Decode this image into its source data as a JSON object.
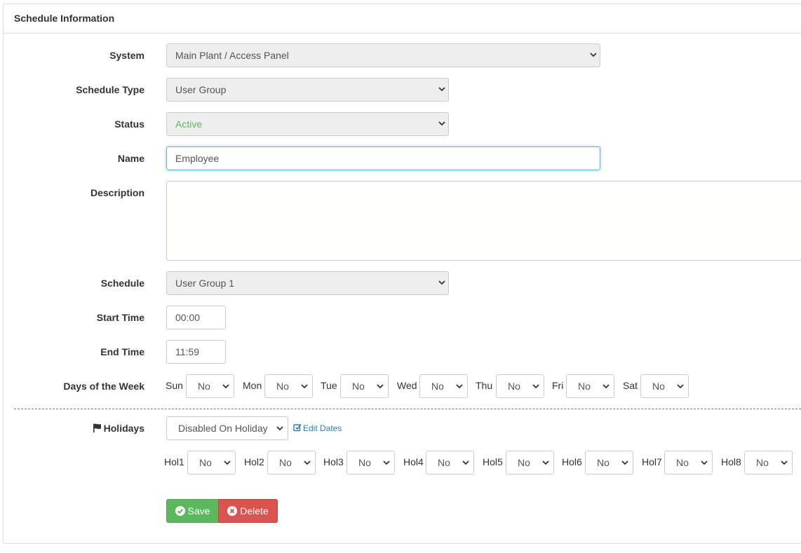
{
  "panel": {
    "title": "Schedule Information"
  },
  "form": {
    "system": {
      "label": "System",
      "value": "Main Plant / Access Panel"
    },
    "schedule_type": {
      "label": "Schedule Type",
      "value": "User Group"
    },
    "status": {
      "label": "Status",
      "value": "Active"
    },
    "name": {
      "label": "Name",
      "value": "Employee"
    },
    "description": {
      "label": "Description",
      "value": ""
    },
    "schedule": {
      "label": "Schedule",
      "value": "User Group 1"
    },
    "start_time": {
      "label": "Start Time",
      "value": "00:00"
    },
    "end_time": {
      "label": "End Time",
      "value": "11:59"
    },
    "days": {
      "label": "Days of the Week",
      "items": [
        {
          "label": "Sun",
          "value": "No"
        },
        {
          "label": "Mon",
          "value": "No"
        },
        {
          "label": "Tue",
          "value": "No"
        },
        {
          "label": "Wed",
          "value": "No"
        },
        {
          "label": "Thu",
          "value": "No"
        },
        {
          "label": "Fri",
          "value": "No"
        },
        {
          "label": "Sat",
          "value": "No"
        }
      ]
    },
    "holidays": {
      "label": "Holidays",
      "mode": "Disabled On Holiday",
      "edit_link": "Edit Dates",
      "items": [
        {
          "label": "Hol1",
          "value": "No"
        },
        {
          "label": "Hol2",
          "value": "No"
        },
        {
          "label": "Hol3",
          "value": "No"
        },
        {
          "label": "Hol4",
          "value": "No"
        },
        {
          "label": "Hol5",
          "value": "No"
        },
        {
          "label": "Hol6",
          "value": "No"
        },
        {
          "label": "Hol7",
          "value": "No"
        },
        {
          "label": "Hol8",
          "value": "No"
        }
      ]
    }
  },
  "actions": {
    "save": "Save",
    "delete": "Delete"
  },
  "colors": {
    "active_status": "#5cb85c",
    "save": "#5cb85c",
    "delete": "#d9534f",
    "link": "#337ab7"
  },
  "icons": {
    "select": "chevron-down-icon",
    "holidays": "flag-icon",
    "edit": "edit-icon",
    "save": "check-circle-icon",
    "delete": "times-circle-icon"
  }
}
